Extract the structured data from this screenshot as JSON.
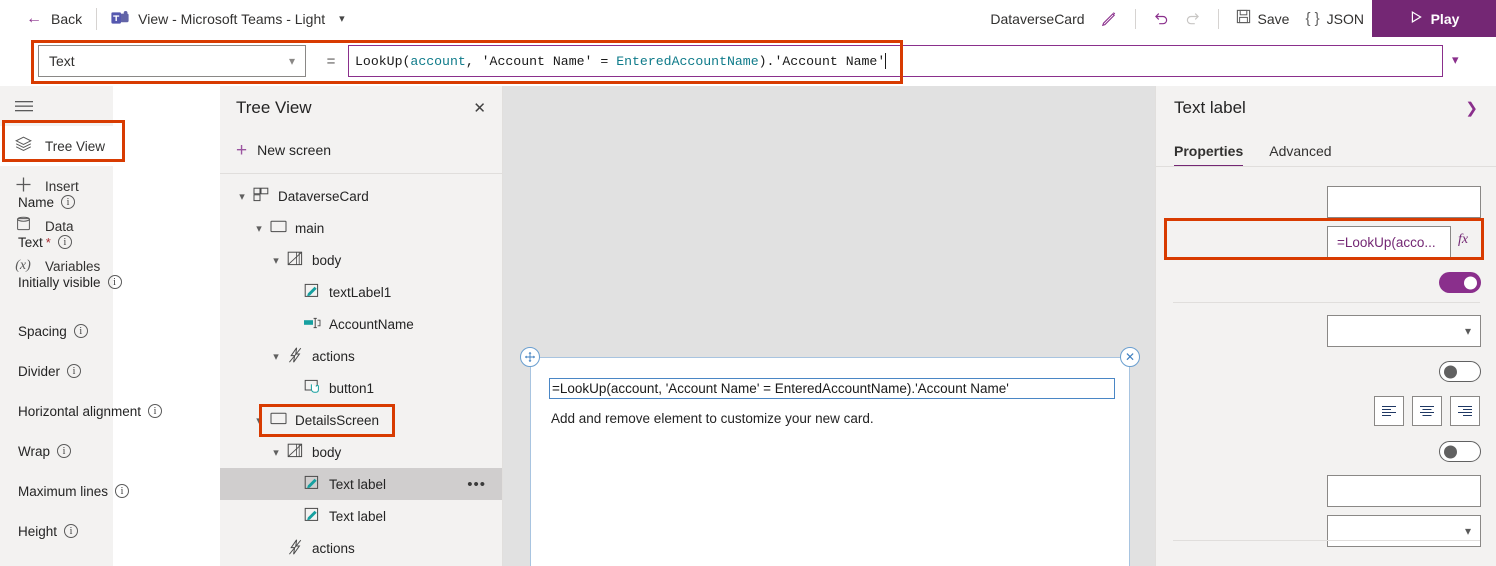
{
  "topbar": {
    "back_label": "Back",
    "back_icon": "arrow-left-icon",
    "app_title": "View - Microsoft Teams - Light",
    "app_icon": "microsoft-teams-icon",
    "title_chevron": "chevron-down-icon",
    "card_name": "DataverseCard",
    "edit_icon": "pencil-icon",
    "undo_icon": "undo-arrow-icon",
    "redo_icon": "redo-arrow-icon",
    "save_label": "Save",
    "save_icon": "floppy-disk-icon",
    "json_label": "JSON",
    "json_icon": "curly-braces-icon",
    "play_label": "Play",
    "play_icon": "play-triangle-icon",
    "accent_purple": "#742774"
  },
  "formula_bar": {
    "property_selected": "Text",
    "property_chevron": "chevron-down-icon",
    "equals": "=",
    "expand_chevron": "chevron-down-icon",
    "formula_full": "LookUp(account, 'Account Name' = EnteredAccountName).'Account Name'",
    "tokens": [
      {
        "text": "LookUp(",
        "kind": "plain"
      },
      {
        "text": "account",
        "kind": "name"
      },
      {
        "text": ", 'Account Name' = ",
        "kind": "plain"
      },
      {
        "text": "EnteredAccountName",
        "kind": "name"
      },
      {
        "text": ").'Account Name'",
        "kind": "plain"
      }
    ],
    "token_color_plain": "#1a1a1a",
    "token_color_name": "#0f7b8a"
  },
  "rail": {
    "hamburger_icon": "hamburger-menu-icon",
    "items": [
      {
        "label": "Tree View",
        "icon": "layers-icon",
        "active": true
      },
      {
        "label": "Insert",
        "icon": "plus-icon",
        "active": false
      },
      {
        "label": "Data",
        "icon": "database-icon",
        "active": false
      },
      {
        "label": "Variables",
        "icon": "variable-x-icon",
        "active": false
      }
    ]
  },
  "tree_view": {
    "title": "Tree View",
    "close_icon": "close-icon",
    "new_screen_label": "New screen",
    "new_screen_icon": "plus-icon",
    "nodes": [
      {
        "label": "DataverseCard",
        "icon": "card-layout-icon",
        "depth": 0,
        "caret": "chevron-down-icon",
        "selected": false,
        "menu": false
      },
      {
        "label": "main",
        "icon": "container-icon",
        "depth": 1,
        "caret": "chevron-down-icon",
        "selected": false,
        "menu": false
      },
      {
        "label": "body",
        "icon": "body-region-icon",
        "depth": 2,
        "caret": "chevron-down-icon",
        "selected": false,
        "menu": false
      },
      {
        "label": "textLabel1",
        "icon": "text-label-icon",
        "depth": 3,
        "caret": "",
        "selected": false,
        "menu": false
      },
      {
        "label": "AccountName",
        "icon": "text-input-icon",
        "depth": 3,
        "caret": "",
        "selected": false,
        "menu": false
      },
      {
        "label": "actions",
        "icon": "lightning-icon",
        "depth": 2,
        "caret": "chevron-down-icon",
        "selected": false,
        "menu": false
      },
      {
        "label": "button1",
        "icon": "button-icon",
        "depth": 3,
        "caret": "",
        "selected": false,
        "menu": false
      },
      {
        "label": "DetailsScreen",
        "icon": "container-icon",
        "depth": 1,
        "caret": "chevron-down-icon",
        "selected": false,
        "menu": false
      },
      {
        "label": "body",
        "icon": "body-region-icon",
        "depth": 2,
        "caret": "chevron-down-icon",
        "selected": false,
        "menu": false
      },
      {
        "label": "Text label",
        "icon": "text-label-icon",
        "depth": 3,
        "caret": "",
        "selected": true,
        "menu": true
      },
      {
        "label": "Text label",
        "icon": "text-label-icon",
        "depth": 3,
        "caret": "",
        "selected": false,
        "menu": false
      },
      {
        "label": "actions",
        "icon": "lightning-icon",
        "depth": 2,
        "caret": "",
        "selected": false,
        "menu": false
      }
    ],
    "row_menu_icon": "ellipsis-icon"
  },
  "canvas": {
    "move_handle_icon": "move-four-arrows-icon",
    "close_icon": "close-circle-icon",
    "field_value": "=LookUp(account, 'Account Name' = EnteredAccountName).'Account Name'",
    "body_text": "Add and remove element to customize your new card."
  },
  "properties": {
    "title": "Text label",
    "expand_icon": "chevron-right-icon",
    "tabs": [
      {
        "label": "Properties",
        "active": true
      },
      {
        "label": "Advanced",
        "active": false
      }
    ],
    "info_icon": "info-circle-icon",
    "fx_icon": "fx-icon",
    "rows": [
      {
        "label": "Name",
        "type": "text",
        "value": ""
      },
      {
        "label": "Text",
        "type": "text-fx",
        "value": "=LookUp(acco...",
        "required": true
      },
      {
        "label": "Initially visible",
        "type": "toggle",
        "value": "on"
      },
      {
        "label": "Spacing",
        "type": "select",
        "value": ""
      },
      {
        "label": "Divider",
        "type": "toggle",
        "value": "off"
      },
      {
        "label": "Horizontal alignment",
        "type": "align",
        "value": ""
      },
      {
        "label": "Wrap",
        "type": "toggle",
        "value": "off"
      },
      {
        "label": "Maximum lines",
        "type": "text",
        "value": ""
      },
      {
        "label": "Height",
        "type": "select",
        "value": ""
      }
    ],
    "align_options": [
      {
        "name": "align-left-icon"
      },
      {
        "name": "align-center-icon"
      },
      {
        "name": "align-right-icon"
      }
    ]
  },
  "annotations": {
    "color": "#d83b01",
    "boxes": [
      {
        "name": "formula-bar-highlight"
      },
      {
        "name": "tree-view-rail-highlight"
      },
      {
        "name": "details-screen-node-highlight"
      },
      {
        "name": "text-property-highlight"
      }
    ]
  }
}
